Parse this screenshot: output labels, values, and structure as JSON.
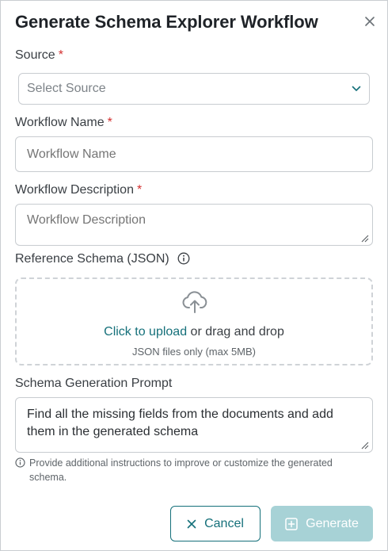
{
  "dialog": {
    "title": "Generate Schema Explorer Workflow",
    "close_icon": "close-icon"
  },
  "source": {
    "label": "Source",
    "required_mark": "*",
    "placeholder": "Select Source",
    "icon": "chevron-down-icon"
  },
  "workflow_name": {
    "label": "Workflow Name",
    "required_mark": "*",
    "placeholder": "Workflow Name"
  },
  "workflow_description": {
    "label": "Workflow Description",
    "required_mark": "*",
    "placeholder": "Workflow Description"
  },
  "reference_schema": {
    "label": "Reference Schema (JSON)",
    "info_icon": "info-icon",
    "upload_icon": "cloud-upload-icon",
    "upload_link": "Click to upload",
    "upload_rest": " or drag and drop",
    "hint": "JSON files only (max 5MB)"
  },
  "prompt": {
    "label": "Schema Generation Prompt",
    "value": "Find all the missing fields from the documents and add them in the generated schema",
    "helper_icon": "info-icon",
    "helper": "Provide additional instructions to improve or customize the generated schema."
  },
  "footer": {
    "cancel_label": "Cancel",
    "cancel_icon": "close-icon",
    "generate_label": "Generate",
    "generate_icon": "plus-square-icon"
  },
  "colors": {
    "accent": "#15707a",
    "accent_disabled": "#a7d2d6",
    "required": "#d32f2f"
  }
}
